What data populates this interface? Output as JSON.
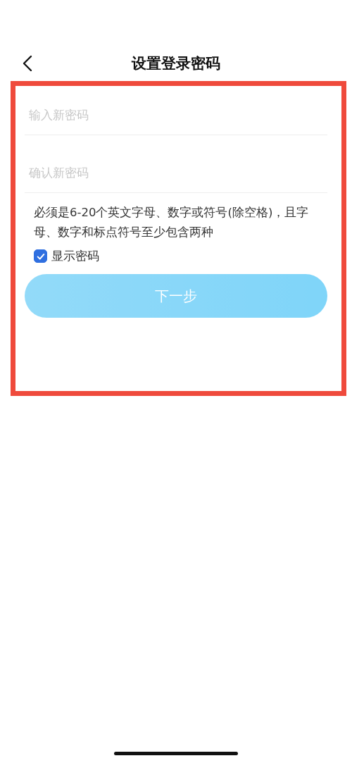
{
  "header": {
    "title": "设置登录密码"
  },
  "fields": [
    {
      "placeholder": "输入新密码"
    },
    {
      "placeholder": "确认新密码"
    }
  ],
  "hint": "必须是6-20个英文字母、数字或符号(除空格)，且字母、数字和标点符号至少包含两种",
  "show_password": {
    "label": "显示密码",
    "checked": true
  },
  "next_button": {
    "label": "下一步",
    "disabled": true
  }
}
